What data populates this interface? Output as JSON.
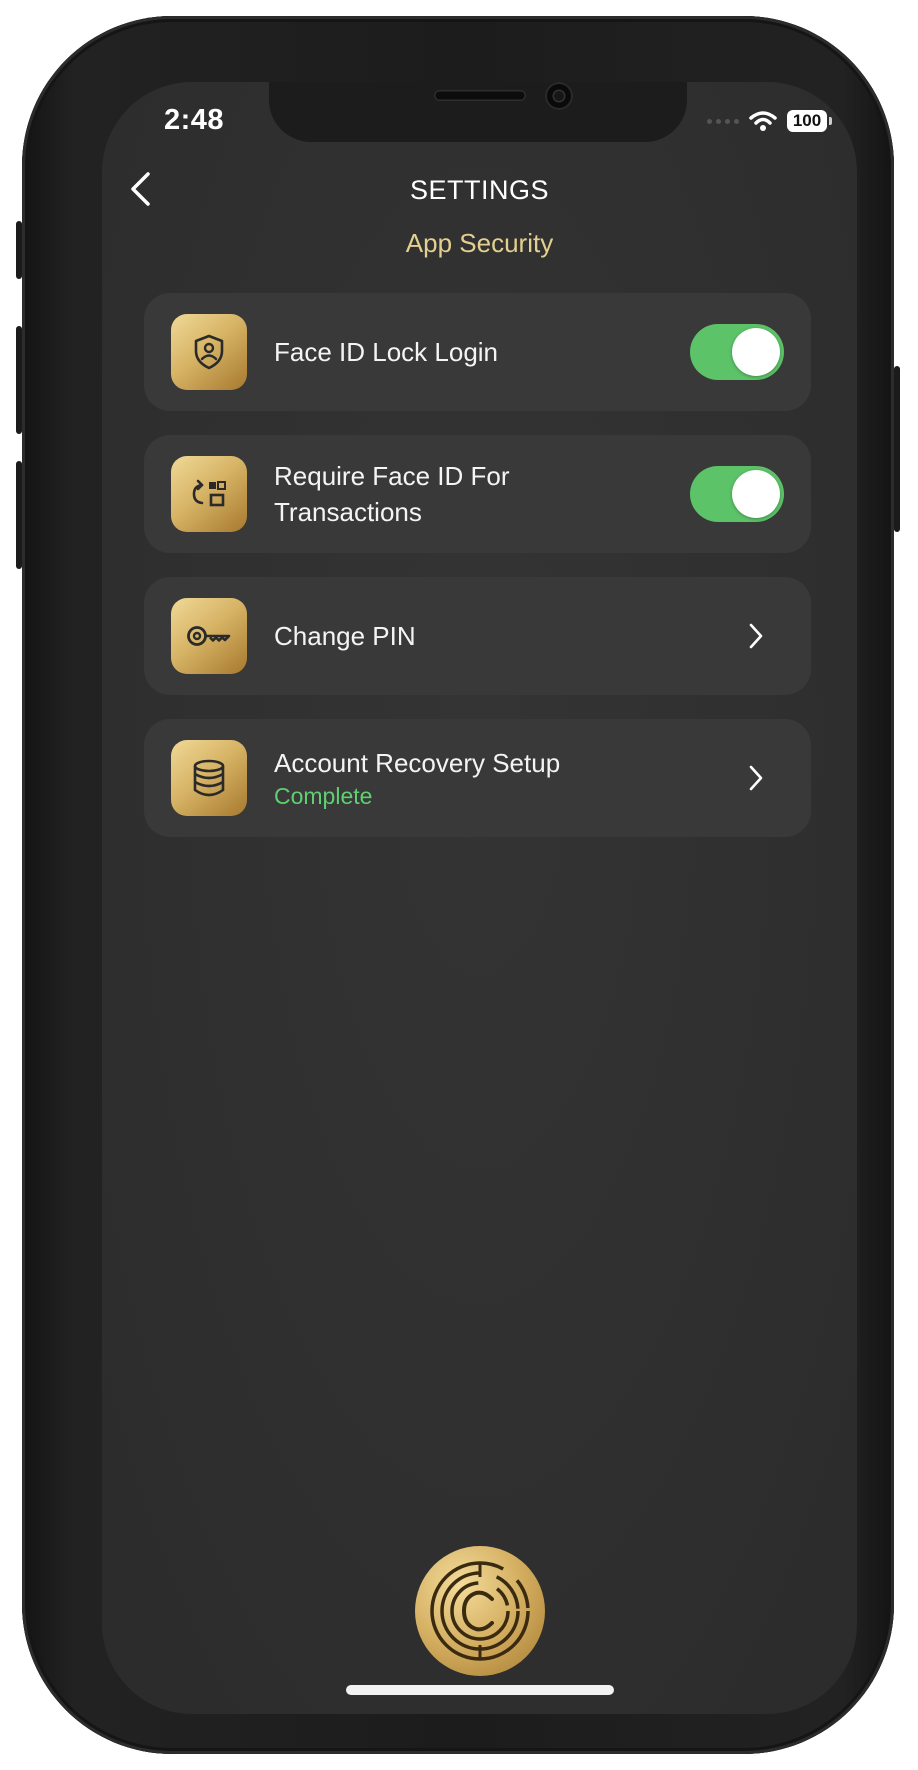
{
  "status_bar": {
    "time": "2:48",
    "battery": "100"
  },
  "header": {
    "title": "SETTINGS",
    "section": "App Security"
  },
  "settings": [
    {
      "label": "Face ID Lock Login",
      "icon": "shield-user-icon",
      "control": "toggle",
      "enabled": true
    },
    {
      "label": "Require Face ID For Transactions",
      "icon": "refresh-qr-icon",
      "control": "toggle",
      "enabled": true
    },
    {
      "label": "Change PIN",
      "icon": "key-icon",
      "control": "chevron"
    },
    {
      "label": "Account Recovery Setup",
      "sublabel": "Complete",
      "icon": "database-icon",
      "control": "chevron"
    }
  ],
  "colors": {
    "accent_gold": "#e3cf8f",
    "toggle_on": "#5cc368",
    "status_complete": "#5fcf72",
    "card_bg": "#393939",
    "screen_bg": "#2f2f2f"
  }
}
